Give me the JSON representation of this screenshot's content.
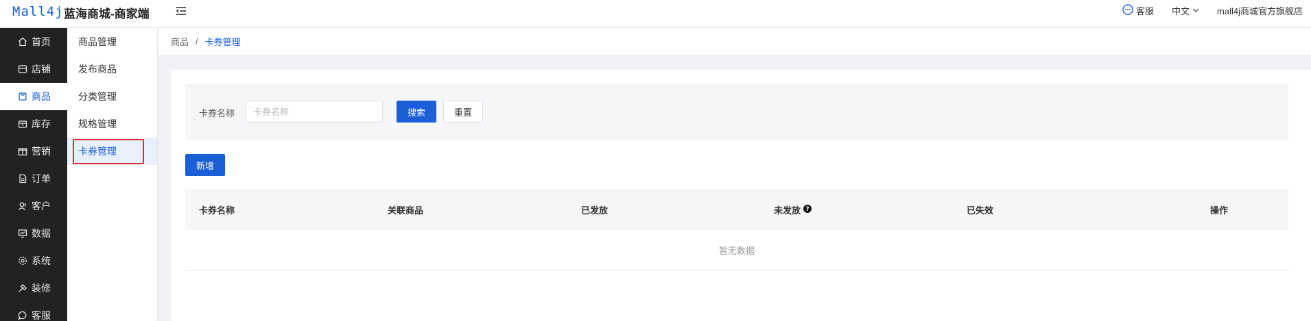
{
  "header": {
    "logo": "Mall4j",
    "title": "蓝海商城-商家端",
    "service_label": "客服",
    "language": "中文",
    "store_name": "mall4j商城官方旗舰店"
  },
  "sidebar": {
    "items": [
      {
        "label": "首页",
        "icon": "home-icon"
      },
      {
        "label": "店铺",
        "icon": "store-icon"
      },
      {
        "label": "商品",
        "icon": "product-icon"
      },
      {
        "label": "库存",
        "icon": "inventory-icon"
      },
      {
        "label": "营销",
        "icon": "gift-icon"
      },
      {
        "label": "订单",
        "icon": "order-icon"
      },
      {
        "label": "客户",
        "icon": "customer-icon"
      },
      {
        "label": "数据",
        "icon": "data-icon"
      },
      {
        "label": "系统",
        "icon": "settings-icon"
      },
      {
        "label": "装修",
        "icon": "decorate-icon"
      },
      {
        "label": "客服",
        "icon": "chat-icon"
      }
    ],
    "active_index": 2
  },
  "submenu": {
    "items": [
      "商品管理",
      "发布商品",
      "分类管理",
      "规格管理",
      "卡券管理"
    ],
    "active_index": 4
  },
  "breadcrumb": {
    "parent": "商品",
    "separator": "/",
    "current": "卡券管理"
  },
  "search": {
    "label": "卡券名称",
    "placeholder": "卡券名称",
    "value": "",
    "search_button": "搜索",
    "reset_button": "重置"
  },
  "add_button": "新增",
  "table": {
    "columns": [
      "卡券名称",
      "关联商品",
      "已发放",
      "未发放",
      "已失效",
      "操作"
    ],
    "empty_text": "暂无数据"
  },
  "colors": {
    "primary": "#1a5fd6",
    "sidebar_bg": "#222222",
    "highlight_border": "#e32d2d"
  }
}
